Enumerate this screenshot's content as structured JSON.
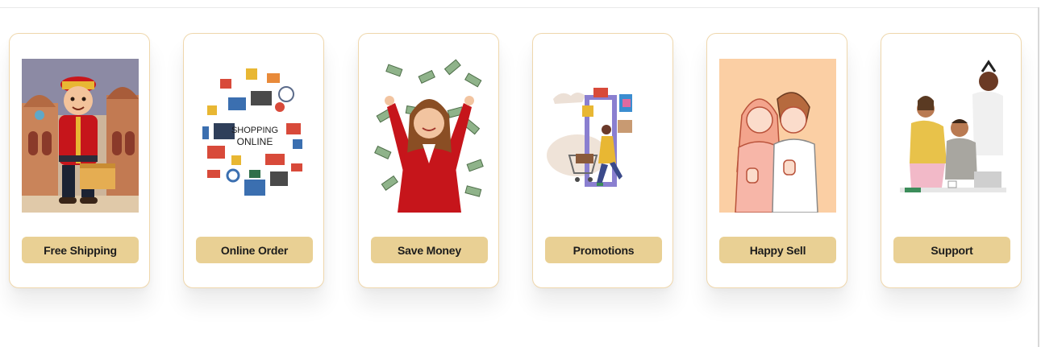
{
  "features": [
    {
      "label": "Free Shipping"
    },
    {
      "label": "Online Order",
      "image_text": [
        "SHOPPING",
        "ONLINE"
      ]
    },
    {
      "label": "Save Money"
    },
    {
      "label": "Promotions"
    },
    {
      "label": "Happy Sell"
    },
    {
      "label": "Support"
    }
  ],
  "colors": {
    "button_bg": "#e9d094",
    "card_border": "#efd7ac",
    "accent_red": "#c6151b"
  }
}
